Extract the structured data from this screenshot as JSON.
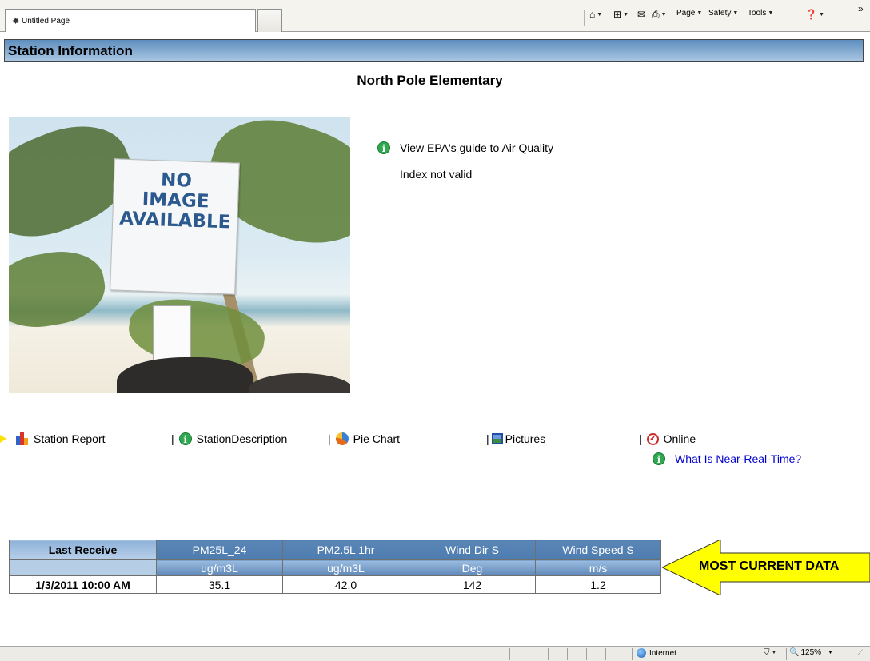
{
  "browser": {
    "tab_title": "Untitled Page",
    "commands": {
      "page": "Page",
      "safety": "Safety",
      "tools": "Tools",
      "more": "»"
    }
  },
  "page": {
    "header": "Station Information",
    "station_name": "North Pole Elementary",
    "photo_sign": [
      "NO",
      "IMAGE",
      "AVAILABLE"
    ],
    "aqi_link": "View EPA's guide to Air Quality",
    "aqi_status": "Index not valid"
  },
  "links": {
    "station_report": "Station Report",
    "station_description": "StationDescription",
    "pie_chart": "Pie Chart",
    "pictures": "Pictures",
    "online": "Online",
    "near_real_time": "What Is Near-Real-Time?",
    "separator": "|"
  },
  "table": {
    "header": [
      "Last Receive",
      "PM25L_24",
      "PM2.5L 1hr",
      "Wind Dir S",
      "Wind Speed S"
    ],
    "units": [
      "",
      "ug/m3L",
      "ug/m3L",
      "Deg",
      "m/s"
    ],
    "rows": [
      [
        "1/3/2011 10:00 AM",
        "35.1",
        "42.0",
        "142",
        "1.2"
      ]
    ]
  },
  "callout": {
    "text": "MOST CURRENT DATA",
    "color": "#ffff00"
  },
  "status_bar": {
    "zone": "Internet",
    "zoom": "125%"
  },
  "colors": {
    "header_blue": "#5e8ebd",
    "table_header": "#4d7cb0",
    "link_blue": "#0000cc",
    "info_green": "#2fa84f"
  }
}
